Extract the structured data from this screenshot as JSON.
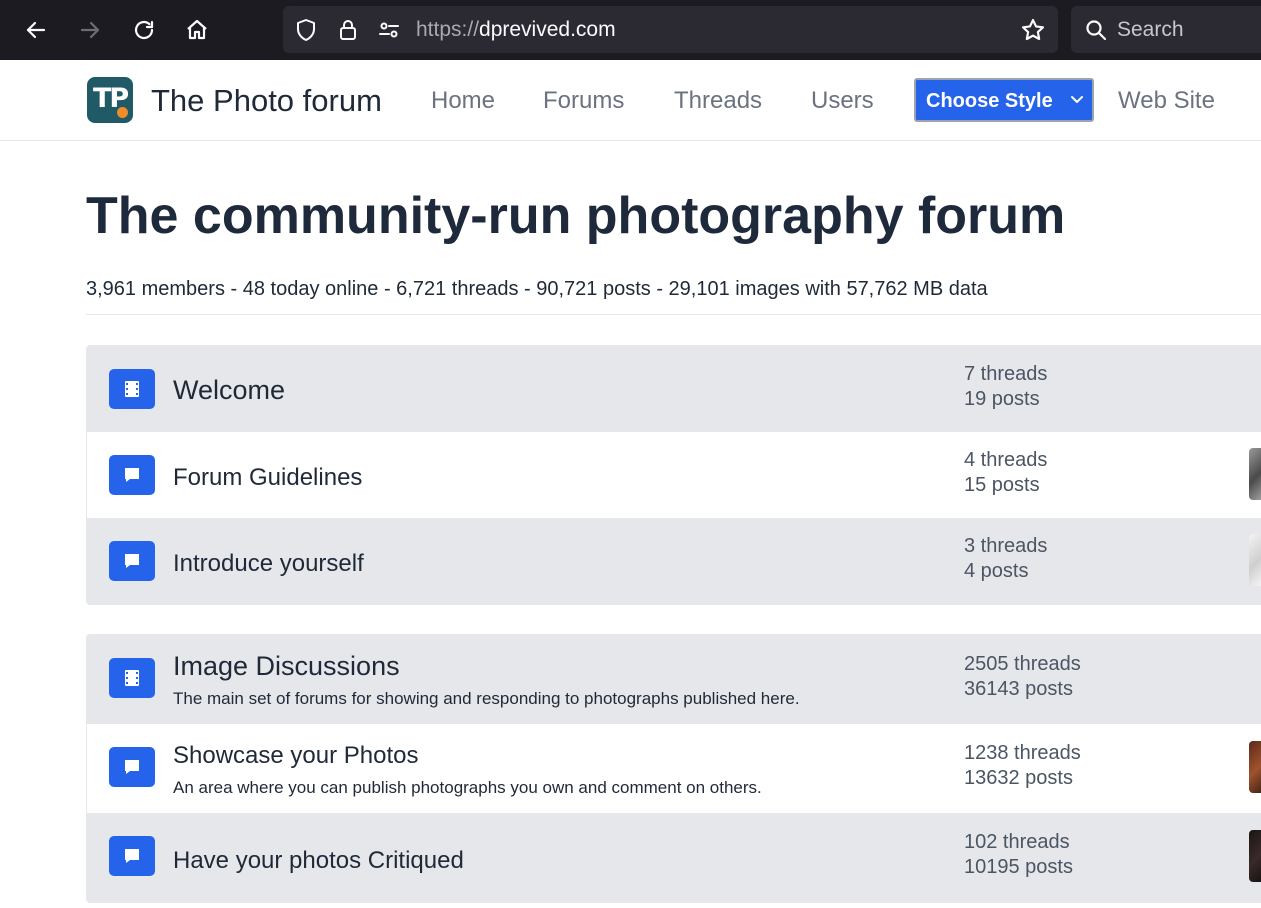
{
  "browser": {
    "url_scheme": "https://",
    "url_host": "dprevived.com",
    "search_placeholder": "Search"
  },
  "site": {
    "title": "The Photo forum",
    "nav": {
      "home": "Home",
      "forums": "Forums",
      "threads": "Threads",
      "users": "Users",
      "choose_style": "Choose Style",
      "web_site": "Web Site"
    }
  },
  "main": {
    "title": "The community-run photography forum",
    "stats": "3,961 members - 48 today online - 6,721 threads - 90,721 posts - 29,101 images with 57,762 MB data"
  },
  "sections": [
    {
      "rows": [
        {
          "kind": "category",
          "title": "Welcome",
          "threads": "7 threads",
          "posts": "19 posts"
        },
        {
          "kind": "forum",
          "title": "Forum Guidelines",
          "threads": "4 threads",
          "posts": "15 posts"
        },
        {
          "kind": "forum",
          "title": "Introduce yourself",
          "threads": "3 threads",
          "posts": "4 posts"
        }
      ]
    },
    {
      "rows": [
        {
          "kind": "category",
          "title": "Image Discussions",
          "description": "The main set of forums for showing and responding to photographs published here.",
          "threads": "2505 threads",
          "posts": "36143 posts"
        },
        {
          "kind": "forum",
          "title": "Showcase your Photos",
          "description": "An area where you can publish photographs you own and comment on others.",
          "threads": "1238 threads",
          "posts": "13632 posts"
        },
        {
          "kind": "forum",
          "title": "Have your photos Critiqued",
          "threads": "102 threads",
          "posts": "10195 posts"
        }
      ]
    }
  ],
  "colors": {
    "accent": "#2563eb",
    "browser_chrome": "#1c1b22",
    "row_gray": "#e5e7eb",
    "logo_teal": "#1f5a66",
    "logo_orange": "#f28c28"
  },
  "icons": {
    "category": "film-strip-icon",
    "forum": "chat-bubble-icon"
  }
}
